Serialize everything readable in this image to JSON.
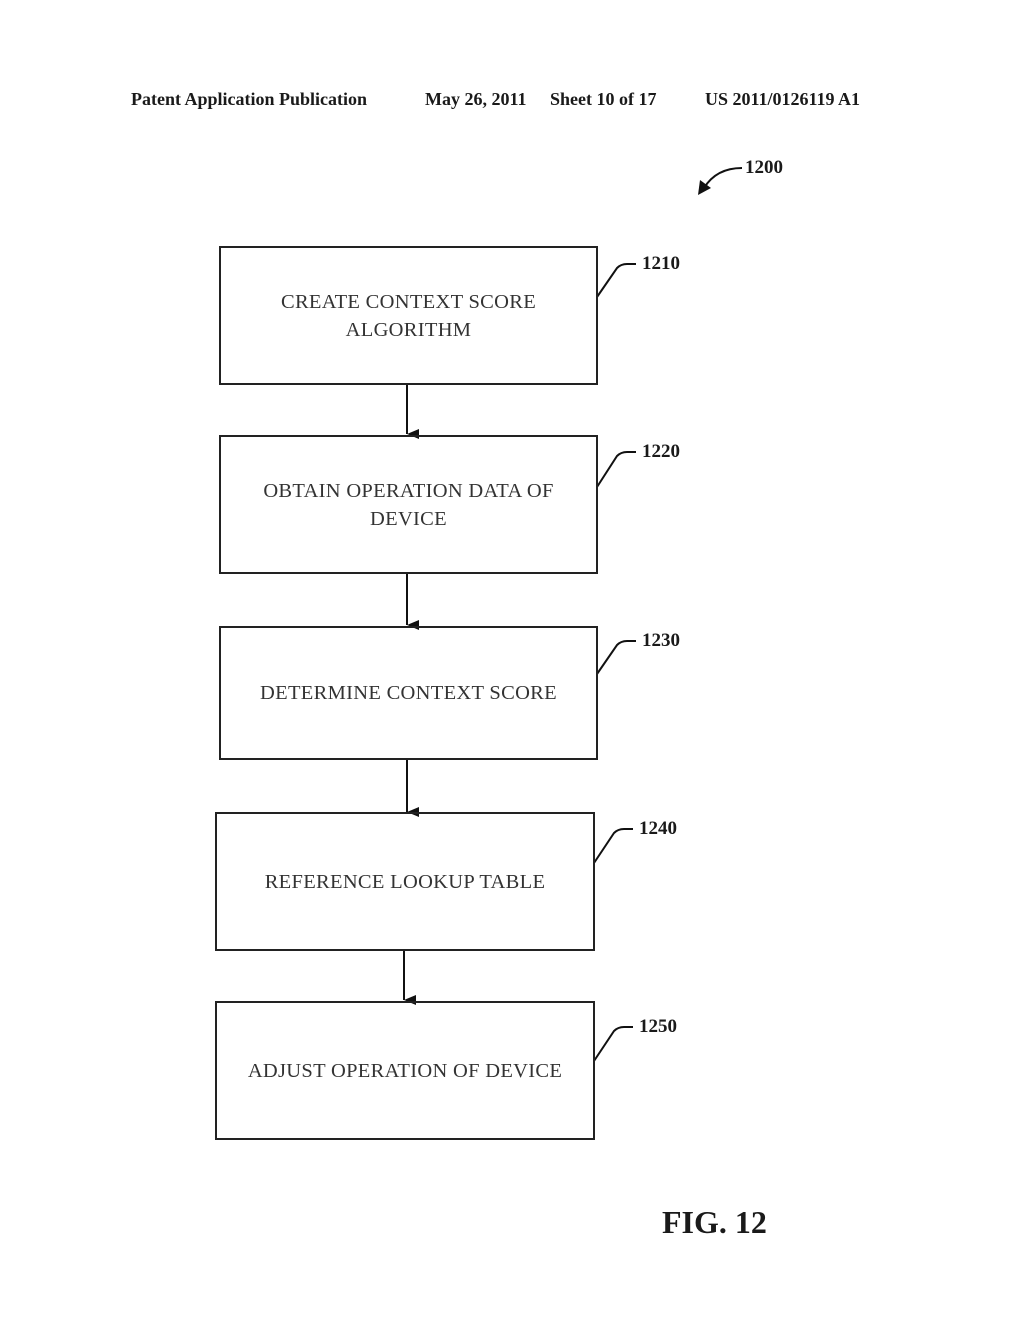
{
  "header": {
    "publication": "Patent Application Publication",
    "date": "May 26, 2011",
    "sheet": "Sheet 10 of 17",
    "number": "US 2011/0126119 A1"
  },
  "figure": {
    "ref": "1200",
    "label": "FIG. 12"
  },
  "steps": [
    {
      "ref": "1210",
      "text": "CREATE CONTEXT SCORE ALGORITHM"
    },
    {
      "ref": "1220",
      "text": "OBTAIN OPERATION DATA OF DEVICE"
    },
    {
      "ref": "1230",
      "text": "DETERMINE CONTEXT SCORE"
    },
    {
      "ref": "1240",
      "text": "REFERENCE LOOKUP TABLE"
    },
    {
      "ref": "1250",
      "text": "ADJUST OPERATION OF DEVICE"
    }
  ]
}
